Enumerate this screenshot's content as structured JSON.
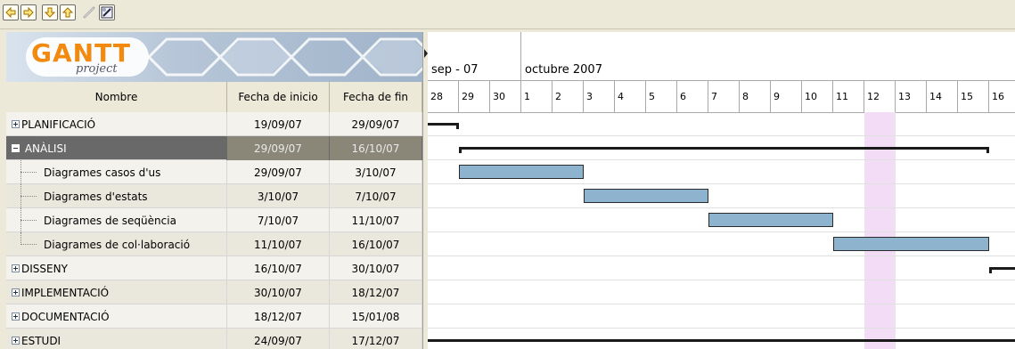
{
  "toolbar": {
    "buttons": [
      "arrow-left-icon",
      "arrow-right-icon",
      "arrow-down-icon",
      "arrow-up-icon",
      "unlink-icon",
      "link-icon"
    ]
  },
  "logo": {
    "brand": "GANTT",
    "sub": "project"
  },
  "table": {
    "headers": [
      "Nombre",
      "Fecha de inicio",
      "Fecha de fin"
    ],
    "rows": [
      {
        "name": "PLANIFICACIÓ",
        "start": "19/09/07",
        "end": "29/09/07",
        "kind": "group-collapsed"
      },
      {
        "name": "ANÀLISI",
        "start": "29/09/07",
        "end": "16/10/07",
        "kind": "group-expanded",
        "selected": true
      },
      {
        "name": "Diagrames casos d'us",
        "start": "29/09/07",
        "end": "3/10/07",
        "kind": "child"
      },
      {
        "name": "Diagrames d'estats",
        "start": "3/10/07",
        "end": "7/10/07",
        "kind": "child"
      },
      {
        "name": "Diagrames de seqüència",
        "start": "7/10/07",
        "end": "11/10/07",
        "kind": "child"
      },
      {
        "name": "Diagrames de col·laboració",
        "start": "11/10/07",
        "end": "16/10/07",
        "kind": "child-last"
      },
      {
        "name": "DISSENY",
        "start": "16/10/07",
        "end": "30/10/07",
        "kind": "group-collapsed"
      },
      {
        "name": "IMPLEMENTACIÓ",
        "start": "30/10/07",
        "end": "18/12/07",
        "kind": "group-collapsed"
      },
      {
        "name": "DOCUMENTACIÓ",
        "start": "18/12/07",
        "end": "15/01/08",
        "kind": "group-collapsed"
      },
      {
        "name": "ESTUDI",
        "start": "24/09/07",
        "end": "17/12/07",
        "kind": "group-collapsed"
      }
    ]
  },
  "timeline": {
    "months": [
      "sep - 07",
      "octubre 2007"
    ],
    "days": [
      "28",
      "29",
      "30",
      "1",
      "2",
      "3",
      "4",
      "5",
      "6",
      "7",
      "8",
      "9",
      "10",
      "11",
      "12",
      "13",
      "14",
      "15",
      "16"
    ],
    "today_label": "12"
  },
  "colors": {
    "task_bar": "#8eb3cf",
    "summary_bar": "#1a1a1a",
    "today_highlight": "#f3dcf5",
    "selection": "#69696a"
  }
}
